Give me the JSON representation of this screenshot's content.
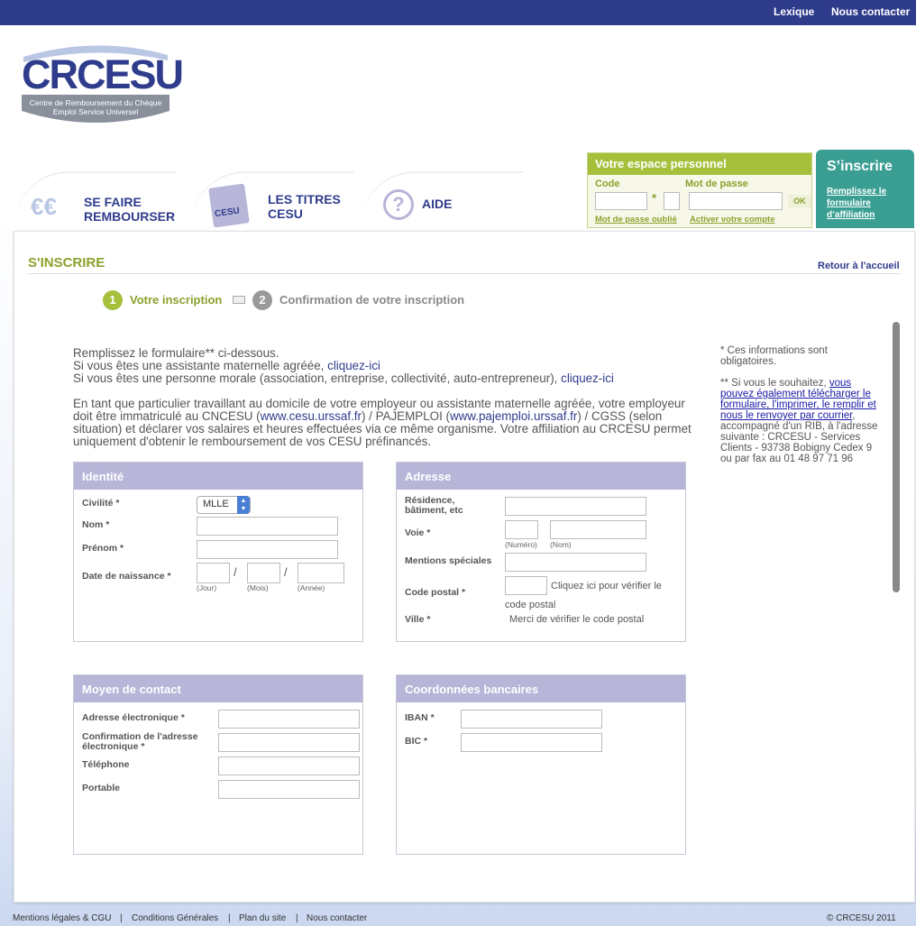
{
  "header": {
    "lexique": "Lexique",
    "contact": "Nous contacter"
  },
  "logo": {
    "name": "CRCESU",
    "subtitle1": "Centre de Remboursement du Chèque",
    "subtitle2": "Emploi Service Universel"
  },
  "nav": {
    "remb1": "SE FAIRE",
    "remb2": "REMBOURSER",
    "titres1": "LES TITRES",
    "titres2": "CESU",
    "aide": "AIDE"
  },
  "espace": {
    "title": "Votre espace personnel",
    "code": "Code",
    "mdp": "Mot de passe",
    "ok": "OK",
    "oubli": "Mot de passe oublié",
    "activer": "Activer votre compte"
  },
  "inscrire": {
    "title": "S’inscrire",
    "l1": "Remplissez le",
    "l2": "formulaire",
    "l3": "d’affiliation"
  },
  "page": {
    "title": "S'INSCRIRE",
    "retour": "Retour à l'accueil"
  },
  "steps": {
    "s1": "Votre inscription",
    "s2": "Confirmation de votre inscription"
  },
  "intro": {
    "l1": "Remplissez le formulaire** ci-dessous.",
    "l2a": "Si vous êtes une assistante maternelle agréée, ",
    "l2b": "cliquez-ici",
    "l3a": "Si vous êtes une personne morale (association, entreprise, collectivité, auto-entrepreneur), ",
    "l3b": "cliquez-ici",
    "p2a": "En tant que particulier travaillant au domicile de votre employeur ou assistante maternelle agréée, votre employeur doit être immatriculé au CNCESU (",
    "p2b": "www.cesu.urssaf.fr",
    "p2c": ") / PAJEMPLOI (",
    "p2d": "www.pajemploi.urssaf.fr",
    "p2e": ") / CGSS (selon situation) et déclarer vos salaires et heures effectuées via ce même organisme. Votre affiliation au CRCESU permet uniquement d'obtenir le remboursement de vos CESU préfinancés."
  },
  "side": {
    "n1": "* Ces informations sont obligatoires.",
    "n2a": "** Si vous le souhaitez, ",
    "n2b": "vous pouvez également télécharger le formulaire, l'imprimer, le remplir et nous le renvoyer par courrier",
    "n2c": ", accompagné d'un RIB, à l'adresse suivante : CRCESU - Services Clients - 93738 Bobigny Cedex 9 ou par fax au 01 48 97 71 96"
  },
  "identite": {
    "title": "Identité",
    "civilite": "Civilité *",
    "civ_value": "MLLE",
    "nom": "Nom *",
    "prenom": "Prénom *",
    "naissance": "Date de naissance *",
    "jour": "(Jour)",
    "mois": "(Mois)",
    "annee": "(Année)",
    "slash": "/"
  },
  "adresse": {
    "title": "Adresse",
    "residence1": "Résidence,",
    "residence2": "bâtiment, etc",
    "voie": "Voie *",
    "numero": "(Numéro)",
    "nomv": "(Nom)",
    "mentions": "Mentions spéciales",
    "cp": "Code postal *",
    "verif1": "Cliquez ici pour vérifier le",
    "verif2": "code postal",
    "ville": "Ville *",
    "ville_msg": "Merci de vérifier le code postal"
  },
  "contact": {
    "title": "Moyen de contact",
    "email": "Adresse électronique *",
    "conf1": "Confirmation de l'adresse",
    "conf2": "électronique *",
    "tel": "Téléphone",
    "portable": "Portable"
  },
  "banque": {
    "title": "Coordonnées bancaires",
    "iban": "IBAN *",
    "bic": "BIC *"
  },
  "footer": {
    "mentions": "Mentions légales & CGU",
    "cond": "Conditions Générales",
    "plan": "Plan du site",
    "contact": "Nous contacter",
    "copy": "© CRCESU 2011",
    "sep": "|"
  },
  "colors": {
    "navy": "#2f3c8c",
    "green": "#8aa22c",
    "teal": "#3a9e93",
    "lavender": "#b7b5d8"
  }
}
